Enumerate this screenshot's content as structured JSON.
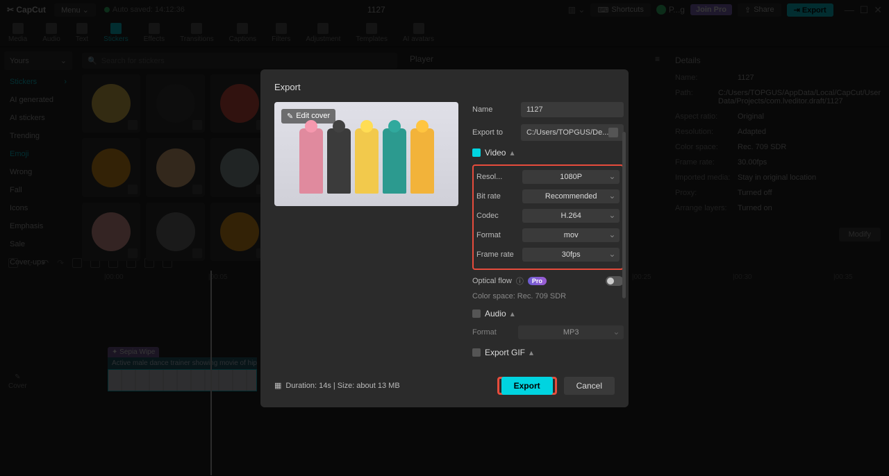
{
  "topbar": {
    "logo": "CapCut",
    "menu": "Menu",
    "autosaved": "Auto saved: 14:12:36",
    "title": "1127",
    "shortcuts": "Shortcuts",
    "user": "P...g",
    "join_pro": "Join Pro",
    "share": "Share",
    "export": "Export"
  },
  "tabs": [
    "Media",
    "Audio",
    "Text",
    "Stickers",
    "Effects",
    "Transitions",
    "Captions",
    "Filters",
    "Adjustment",
    "Templates",
    "AI avatars"
  ],
  "tabs_active_index": 3,
  "sidebar": {
    "header": "Yours",
    "items": [
      "Stickers",
      "AI generated",
      "AI stickers",
      "Trending",
      "Emoji",
      "Wrong",
      "Fall",
      "Icons",
      "Emphasis",
      "Sale",
      "Cover-ups"
    ],
    "active": [
      0,
      4
    ]
  },
  "search_placeholder": "Search for stickers",
  "sticker_colors": [
    "#f2c94c",
    "#333",
    "#e74c3c",
    "#888",
    "#7ab04a",
    "#f39c12",
    "#f2b880",
    "#95a5a6",
    "#9b59b6",
    "#e67ea3",
    "#f5a8a0",
    "#777",
    "#f39c12",
    "#f2c94c",
    "#7ab04a"
  ],
  "player_label": "Player",
  "details": {
    "title": "Details",
    "rows": [
      {
        "k": "Name:",
        "v": "1127"
      },
      {
        "k": "Path:",
        "v": "C:/Users/TOPGUS/AppData/Local/CapCut/User Data/Projects/com.lveditor.draft/1127"
      },
      {
        "k": "Aspect ratio:",
        "v": "Original"
      },
      {
        "k": "Resolution:",
        "v": "Adapted"
      },
      {
        "k": "Color space:",
        "v": "Rec. 709 SDR"
      },
      {
        "k": "Frame rate:",
        "v": "30.00fps"
      },
      {
        "k": "Imported media:",
        "v": "Stay in original location"
      },
      {
        "k": "Proxy:",
        "v": "Turned off"
      },
      {
        "k": "Arrange layers:",
        "v": "Turned on"
      }
    ],
    "modify": "Modify"
  },
  "timeline": {
    "clip_label": "Sepia Wipe",
    "clip_text": "Active male dance trainer showing movie of hip h",
    "ruler": [
      "|00:00",
      "|00:05",
      "|00:25",
      "|00:30",
      "|00:35"
    ]
  },
  "modal": {
    "title": "Export",
    "edit_cover": "Edit cover",
    "name_label": "Name",
    "name_value": "1127",
    "export_to_label": "Export to",
    "export_to_value": "C:/Users/TOPGUS/De...",
    "video_label": "Video",
    "settings": [
      {
        "lbl": "Resol...",
        "val": "1080P"
      },
      {
        "lbl": "Bit rate",
        "val": "Recommended"
      },
      {
        "lbl": "Codec",
        "val": "H.264"
      },
      {
        "lbl": "Format",
        "val": "mov"
      },
      {
        "lbl": "Frame rate",
        "val": "30fps"
      }
    ],
    "optical_flow": "Optical flow",
    "pro": "Pro",
    "color_space": "Color space: Rec. 709 SDR",
    "audio_label": "Audio",
    "audio_format_label": "Format",
    "audio_format_value": "MP3",
    "gif_label": "Export GIF",
    "duration": "Duration: 14s | Size: about 13 MB",
    "export_btn": "Export",
    "cancel_btn": "Cancel",
    "dancer_colors": [
      "#e08a9e",
      "#3b3b3b",
      "#f2c94c",
      "#2c9a8f",
      "#f2b33a"
    ]
  }
}
